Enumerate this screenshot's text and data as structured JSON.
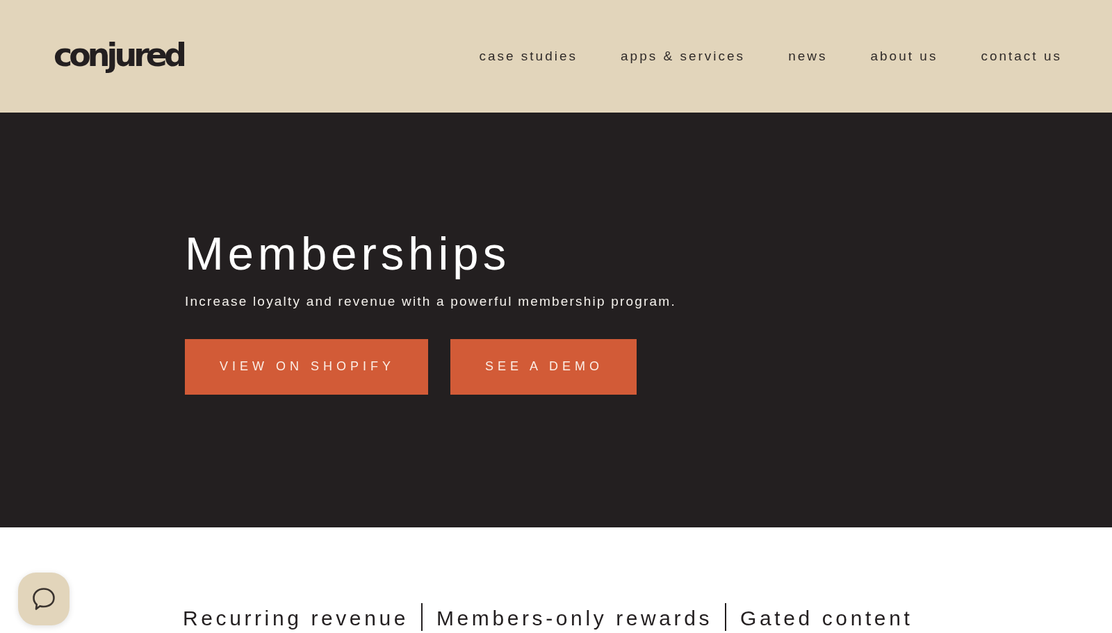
{
  "logo": {
    "text": "conjured"
  },
  "nav": {
    "items": [
      "case studies",
      "apps & services",
      "news",
      "about us",
      "contact us"
    ]
  },
  "hero": {
    "title": "Memberships",
    "subtitle": "Increase loyalty and revenue with a powerful membership program.",
    "buttons": [
      {
        "label": "VIEW ON SHOPIFY"
      },
      {
        "label": "SEE A DEMO"
      }
    ]
  },
  "features": [
    "Recurring revenue",
    "Members-only rewards",
    "Gated content"
  ]
}
